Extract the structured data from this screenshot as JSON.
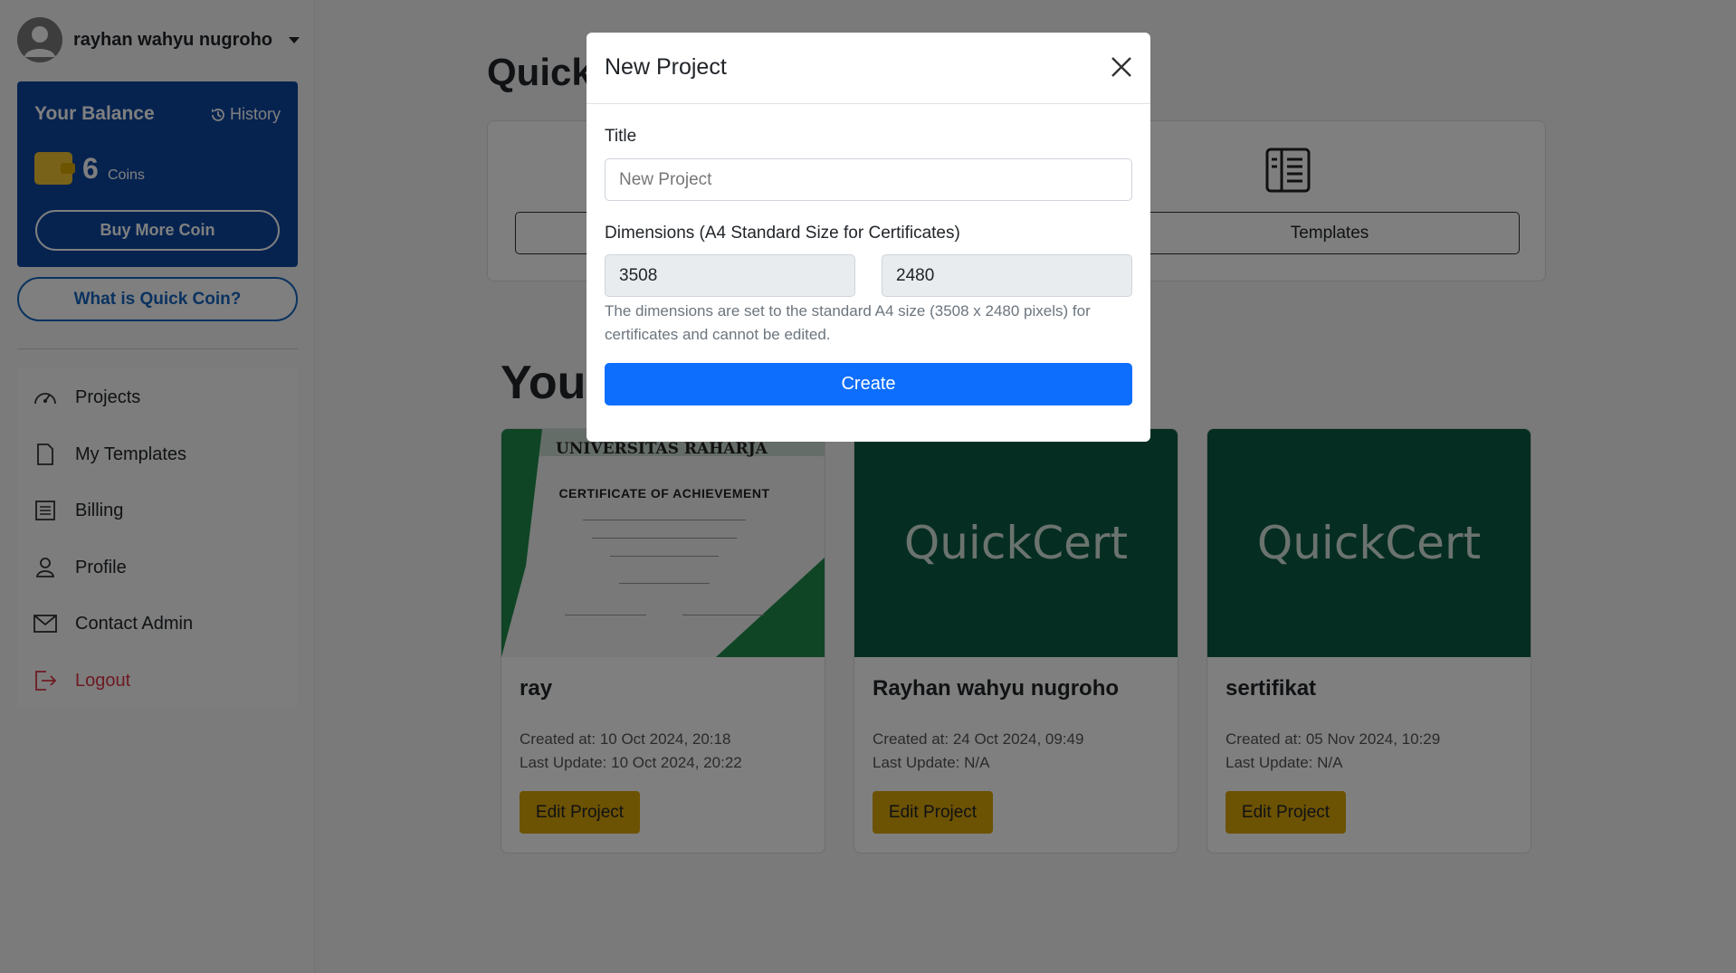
{
  "user": {
    "name": "rayhan wahyu nugroho"
  },
  "balance": {
    "title": "Your Balance",
    "history_label": "History",
    "amount": "6",
    "unit": "Coins",
    "buy_label": "Buy More Coin"
  },
  "what_coin_label": "What is Quick Coin?",
  "menu": [
    {
      "label": "Projects",
      "icon": "speedometer-icon"
    },
    {
      "label": "My Templates",
      "icon": "file-icon"
    },
    {
      "label": "Billing",
      "icon": "list-icon"
    },
    {
      "label": "Profile",
      "icon": "person-icon"
    },
    {
      "label": "Contact Admin",
      "icon": "envelope-icon"
    },
    {
      "label": "Logout",
      "icon": "logout-icon"
    }
  ],
  "main": {
    "quick_title": "Quick",
    "templates_label": "Templates",
    "your_title": "Your"
  },
  "projects": [
    {
      "name": "ray",
      "created": "Created at: 10 Oct 2024, 20:18",
      "updated": "Last Update: 10 Oct 2024, 20:22",
      "edit_label": "Edit Project",
      "thumb": {
        "university": "UNIVERSITAS RAHARJA",
        "heading": "CERTIFICATE OF ACHIEVEMENT"
      }
    },
    {
      "name": "Rayhan wahyu nugroho",
      "created": "Created at: 24 Oct 2024, 09:49",
      "updated": "Last Update: N/A",
      "edit_label": "Edit Project",
      "thumb_text": "QuickCert"
    },
    {
      "name": "sertifikat",
      "created": "Created at: 05 Nov 2024, 10:29",
      "updated": "Last Update: N/A",
      "edit_label": "Edit Project",
      "thumb_text": "QuickCert"
    }
  ],
  "modal": {
    "title": "New Project",
    "title_label": "Title",
    "title_placeholder": "New Project",
    "dimensions_label": "Dimensions (A4 Standard Size for Certificates)",
    "width_value": "3508",
    "height_value": "2480",
    "help_text": "The dimensions are set to the standard A4 size (3508 x 2480 pixels) for certificates and cannot be edited.",
    "create_label": "Create"
  },
  "colors": {
    "balance_bg": "#0d47a1",
    "primary": "#0d6efd",
    "edit_button": "#d9a406",
    "thumb_bg": "#0c5a45",
    "logout": "#dc3545"
  }
}
